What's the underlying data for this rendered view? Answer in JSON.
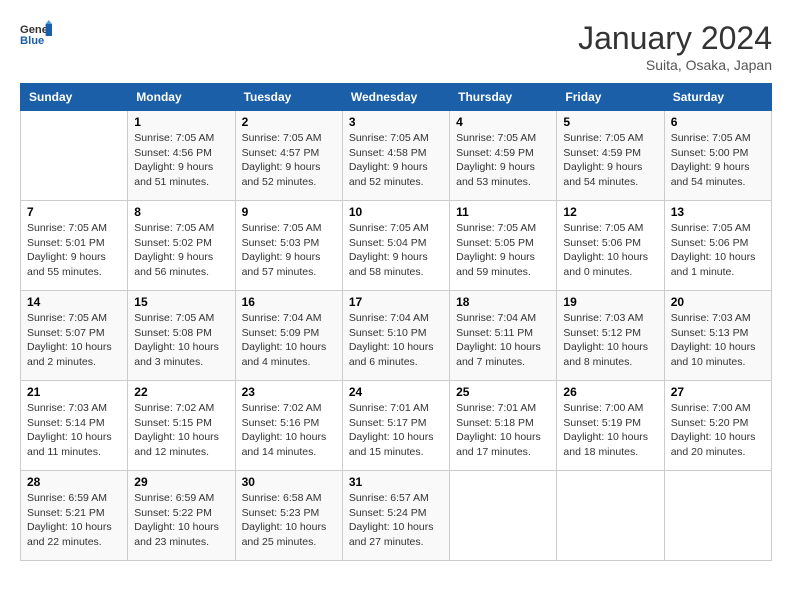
{
  "header": {
    "logo": "GeneralBlue",
    "title": "January 2024",
    "subtitle": "Suita, Osaka, Japan"
  },
  "days_of_week": [
    "Sunday",
    "Monday",
    "Tuesday",
    "Wednesday",
    "Thursday",
    "Friday",
    "Saturday"
  ],
  "weeks": [
    [
      {
        "num": "",
        "info": ""
      },
      {
        "num": "1",
        "info": "Sunrise: 7:05 AM\nSunset: 4:56 PM\nDaylight: 9 hours\nand 51 minutes."
      },
      {
        "num": "2",
        "info": "Sunrise: 7:05 AM\nSunset: 4:57 PM\nDaylight: 9 hours\nand 52 minutes."
      },
      {
        "num": "3",
        "info": "Sunrise: 7:05 AM\nSunset: 4:58 PM\nDaylight: 9 hours\nand 52 minutes."
      },
      {
        "num": "4",
        "info": "Sunrise: 7:05 AM\nSunset: 4:59 PM\nDaylight: 9 hours\nand 53 minutes."
      },
      {
        "num": "5",
        "info": "Sunrise: 7:05 AM\nSunset: 4:59 PM\nDaylight: 9 hours\nand 54 minutes."
      },
      {
        "num": "6",
        "info": "Sunrise: 7:05 AM\nSunset: 5:00 PM\nDaylight: 9 hours\nand 54 minutes."
      }
    ],
    [
      {
        "num": "7",
        "info": "Sunrise: 7:05 AM\nSunset: 5:01 PM\nDaylight: 9 hours\nand 55 minutes."
      },
      {
        "num": "8",
        "info": "Sunrise: 7:05 AM\nSunset: 5:02 PM\nDaylight: 9 hours\nand 56 minutes."
      },
      {
        "num": "9",
        "info": "Sunrise: 7:05 AM\nSunset: 5:03 PM\nDaylight: 9 hours\nand 57 minutes."
      },
      {
        "num": "10",
        "info": "Sunrise: 7:05 AM\nSunset: 5:04 PM\nDaylight: 9 hours\nand 58 minutes."
      },
      {
        "num": "11",
        "info": "Sunrise: 7:05 AM\nSunset: 5:05 PM\nDaylight: 9 hours\nand 59 minutes."
      },
      {
        "num": "12",
        "info": "Sunrise: 7:05 AM\nSunset: 5:06 PM\nDaylight: 10 hours\nand 0 minutes."
      },
      {
        "num": "13",
        "info": "Sunrise: 7:05 AM\nSunset: 5:06 PM\nDaylight: 10 hours\nand 1 minute."
      }
    ],
    [
      {
        "num": "14",
        "info": "Sunrise: 7:05 AM\nSunset: 5:07 PM\nDaylight: 10 hours\nand 2 minutes."
      },
      {
        "num": "15",
        "info": "Sunrise: 7:05 AM\nSunset: 5:08 PM\nDaylight: 10 hours\nand 3 minutes."
      },
      {
        "num": "16",
        "info": "Sunrise: 7:04 AM\nSunset: 5:09 PM\nDaylight: 10 hours\nand 4 minutes."
      },
      {
        "num": "17",
        "info": "Sunrise: 7:04 AM\nSunset: 5:10 PM\nDaylight: 10 hours\nand 6 minutes."
      },
      {
        "num": "18",
        "info": "Sunrise: 7:04 AM\nSunset: 5:11 PM\nDaylight: 10 hours\nand 7 minutes."
      },
      {
        "num": "19",
        "info": "Sunrise: 7:03 AM\nSunset: 5:12 PM\nDaylight: 10 hours\nand 8 minutes."
      },
      {
        "num": "20",
        "info": "Sunrise: 7:03 AM\nSunset: 5:13 PM\nDaylight: 10 hours\nand 10 minutes."
      }
    ],
    [
      {
        "num": "21",
        "info": "Sunrise: 7:03 AM\nSunset: 5:14 PM\nDaylight: 10 hours\nand 11 minutes."
      },
      {
        "num": "22",
        "info": "Sunrise: 7:02 AM\nSunset: 5:15 PM\nDaylight: 10 hours\nand 12 minutes."
      },
      {
        "num": "23",
        "info": "Sunrise: 7:02 AM\nSunset: 5:16 PM\nDaylight: 10 hours\nand 14 minutes."
      },
      {
        "num": "24",
        "info": "Sunrise: 7:01 AM\nSunset: 5:17 PM\nDaylight: 10 hours\nand 15 minutes."
      },
      {
        "num": "25",
        "info": "Sunrise: 7:01 AM\nSunset: 5:18 PM\nDaylight: 10 hours\nand 17 minutes."
      },
      {
        "num": "26",
        "info": "Sunrise: 7:00 AM\nSunset: 5:19 PM\nDaylight: 10 hours\nand 18 minutes."
      },
      {
        "num": "27",
        "info": "Sunrise: 7:00 AM\nSunset: 5:20 PM\nDaylight: 10 hours\nand 20 minutes."
      }
    ],
    [
      {
        "num": "28",
        "info": "Sunrise: 6:59 AM\nSunset: 5:21 PM\nDaylight: 10 hours\nand 22 minutes."
      },
      {
        "num": "29",
        "info": "Sunrise: 6:59 AM\nSunset: 5:22 PM\nDaylight: 10 hours\nand 23 minutes."
      },
      {
        "num": "30",
        "info": "Sunrise: 6:58 AM\nSunset: 5:23 PM\nDaylight: 10 hours\nand 25 minutes."
      },
      {
        "num": "31",
        "info": "Sunrise: 6:57 AM\nSunset: 5:24 PM\nDaylight: 10 hours\nand 27 minutes."
      },
      {
        "num": "",
        "info": ""
      },
      {
        "num": "",
        "info": ""
      },
      {
        "num": "",
        "info": ""
      }
    ]
  ]
}
